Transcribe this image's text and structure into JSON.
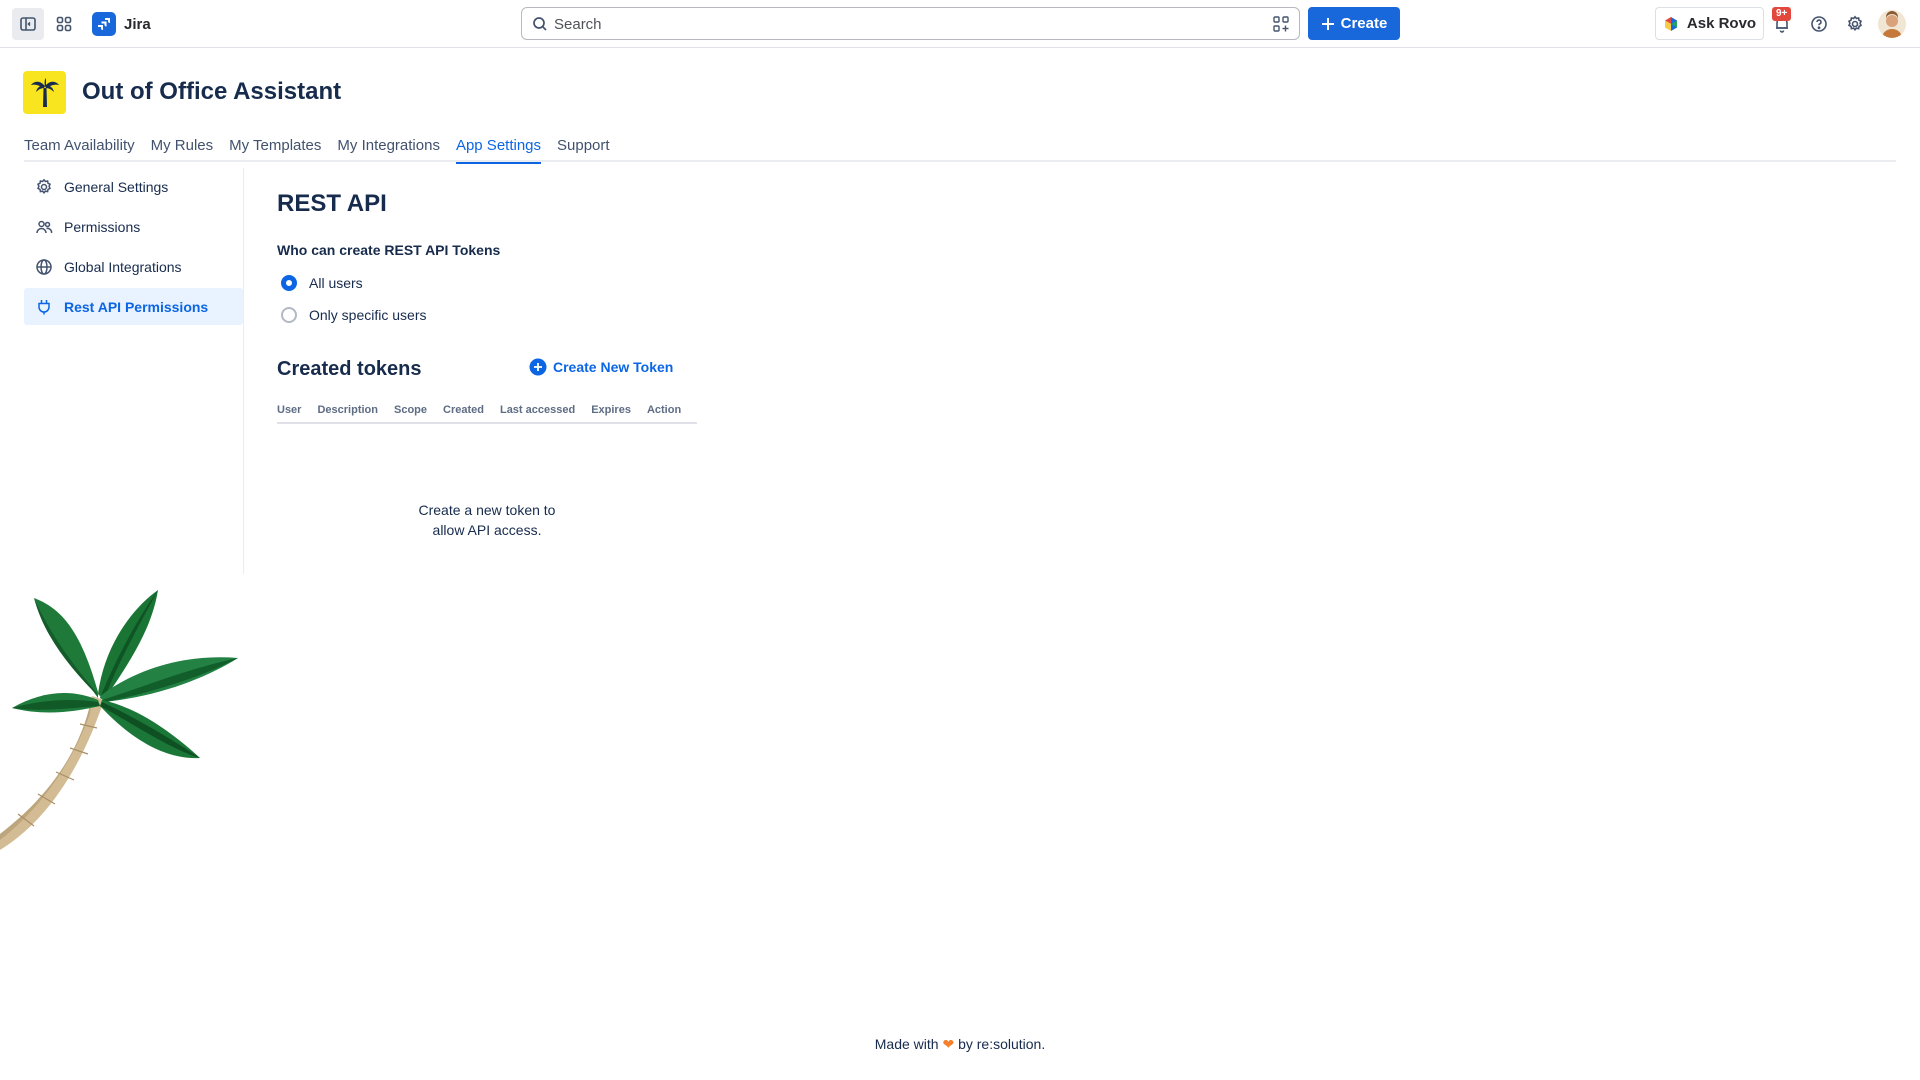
{
  "topnav": {
    "product_name": "Jira",
    "search_placeholder": "Search",
    "create_label": "Create",
    "rovo_label": "Ask Rovo",
    "notification_count": "9+",
    "brand_color": "#1868db"
  },
  "app": {
    "title": "Out of Office Assistant",
    "logo_color": "#f8e51f"
  },
  "tabs": [
    {
      "label": "Team Availability"
    },
    {
      "label": "My Rules"
    },
    {
      "label": "My Templates"
    },
    {
      "label": "My Integrations"
    },
    {
      "label": "App Settings",
      "active": true
    },
    {
      "label": "Support"
    }
  ],
  "sidebar": {
    "items": [
      {
        "label": "General Settings",
        "icon": "gear-icon"
      },
      {
        "label": "Permissions",
        "icon": "people-icon"
      },
      {
        "label": "Global Integrations",
        "icon": "globe-icon"
      },
      {
        "label": "Rest API Permissions",
        "icon": "plug-icon",
        "active": true
      }
    ]
  },
  "main": {
    "title": "REST API",
    "permission_label": "Who can create REST API Tokens",
    "options": [
      {
        "label": "All users",
        "selected": true
      },
      {
        "label": "Only specific users",
        "selected": false
      }
    ],
    "tokens_title": "Created tokens",
    "create_token_label": "Create New Token",
    "table_headers": [
      "User",
      "Description",
      "Scope",
      "Created",
      "Last accessed",
      "Expires",
      "Action"
    ],
    "empty_line1": "Create a new token to",
    "empty_line2": "allow API access."
  },
  "footer": {
    "prefix": "Made with",
    "suffix": "by re:solution."
  }
}
